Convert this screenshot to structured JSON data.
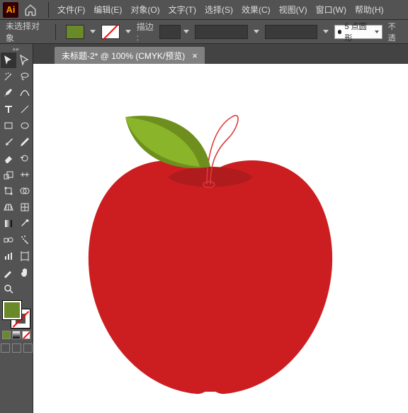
{
  "app": {
    "logo": "Ai"
  },
  "menu": {
    "items": [
      "文件(F)",
      "编辑(E)",
      "对象(O)",
      "文字(T)",
      "选择(S)",
      "效果(C)",
      "视图(V)",
      "窗口(W)",
      "帮助(H)"
    ]
  },
  "control": {
    "selection_status": "未选择对象",
    "fill_color": "#6a8a2a",
    "stroke_label": "描边 :",
    "stroke_width": "",
    "brush_profile": "5 点圆形",
    "opacity_label": "不透"
  },
  "tab": {
    "title": "未标题-2* @ 100% (CMYK/预览)",
    "close": "×"
  },
  "tools": [
    "selection",
    "direct-selection",
    "magic-wand",
    "lasso",
    "pen",
    "curvature",
    "type",
    "line",
    "rectangle",
    "ellipse",
    "paintbrush",
    "pencil",
    "eraser",
    "rotate",
    "scale",
    "width",
    "free-transform",
    "shape-builder",
    "perspective",
    "mesh",
    "gradient",
    "eyedropper",
    "blend",
    "symbol-sprayer",
    "column-graph",
    "artboard",
    "slice",
    "hand",
    "zoom",
    "empty"
  ]
}
